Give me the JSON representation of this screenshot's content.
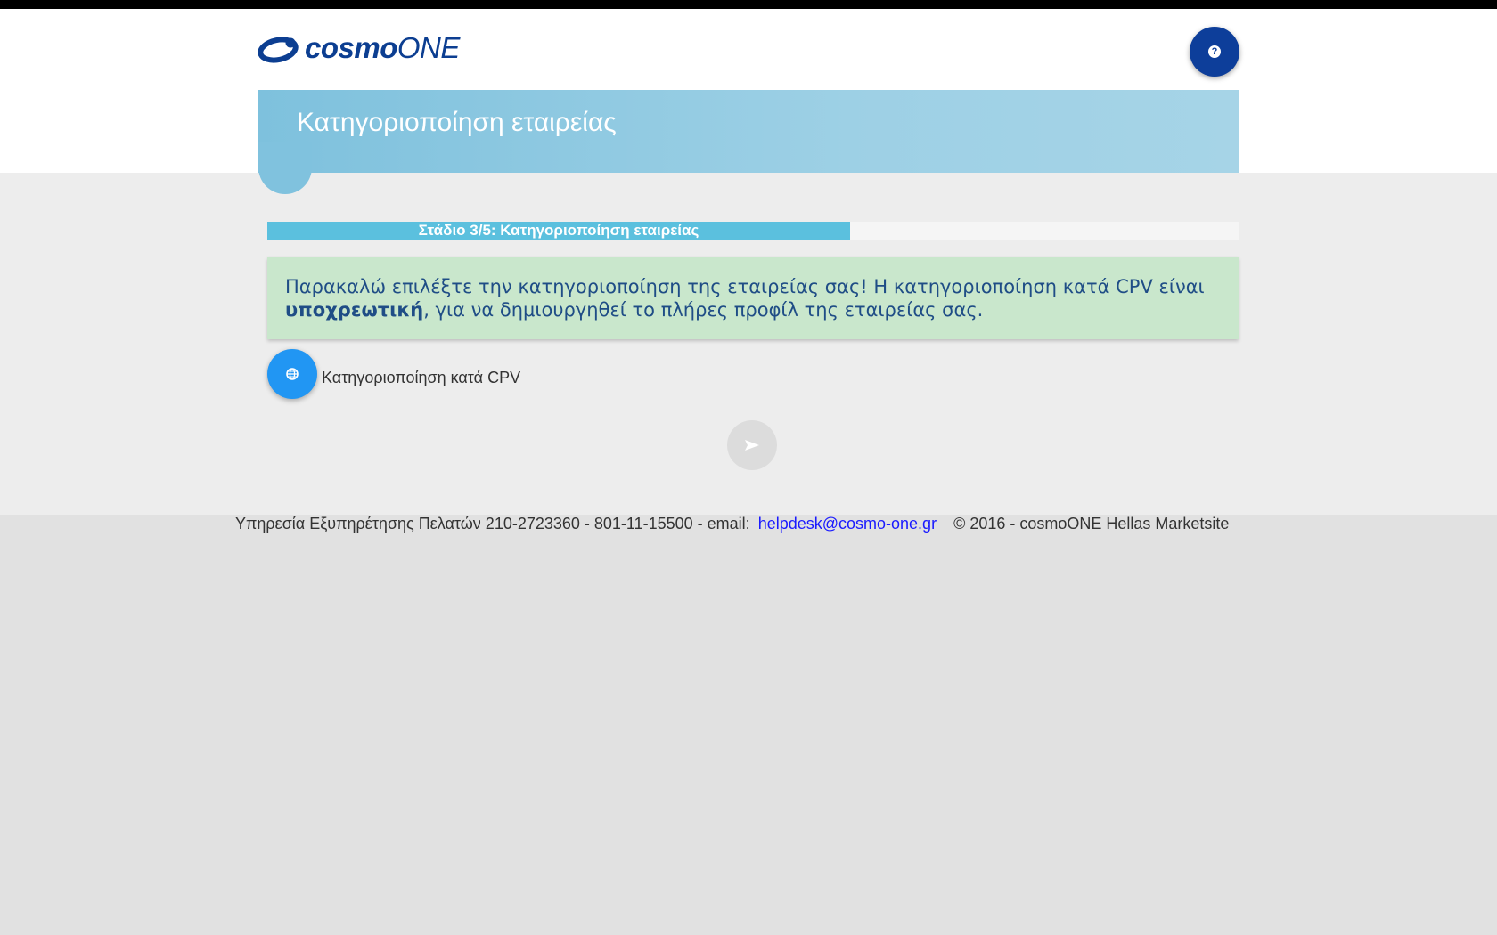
{
  "logo": {
    "bold": "cosmo",
    "light": "ONE"
  },
  "help_button": {
    "symbol": "?"
  },
  "page_title": "Κατηγοριοποίηση εταιρείας",
  "progress": {
    "label": "Στάδιο 3/5: Κατηγοριοποίηση εταιρείας",
    "percent": 60
  },
  "alert": {
    "part1": "Παρακαλώ επιλέξτε την κατηγοριοποίηση της εταιρείας σας! Η κατηγοριοποίηση κατά CPV είναι ",
    "bold": "υποχρεωτική",
    "part2": ", για να δημιουργηθεί το πλήρες προφίλ της εταιρείας σας."
  },
  "cpv": {
    "label": "Κατηγοριοποίηση κατά CPV",
    "icon": "globe-icon"
  },
  "send": {
    "icon": "send-icon"
  },
  "footer": {
    "service_text": "Υπηρεσία Εξυπηρέτησης Πελατών 210-2723360 - 801-11-15500 - email:",
    "email": "helpdesk@cosmo-one.gr",
    "copyright": "© 2016 - cosmoONE Hellas Marketsite"
  },
  "colors": {
    "brand": "#0c3e91",
    "banner": "#7ec1dd",
    "progress": "#5bc0de",
    "alert_bg": "#c9e7cc",
    "cpv_button": "#2196f3"
  }
}
